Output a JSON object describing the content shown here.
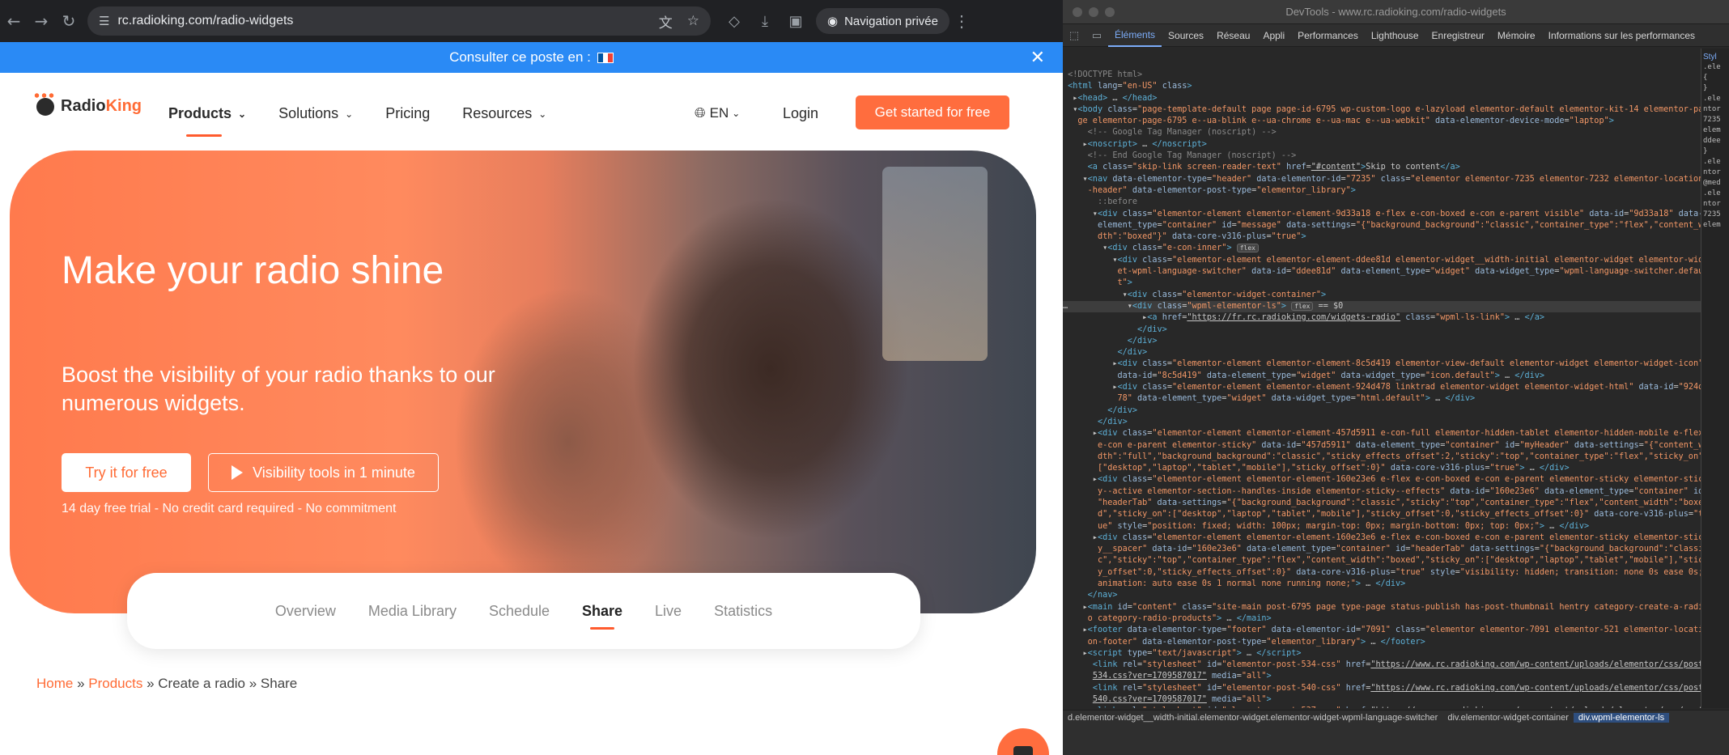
{
  "browser": {
    "url": "rc.radioking.com/radio-widgets",
    "incognito_label": "Navigation privée"
  },
  "banner": {
    "text": "Consulter ce poste en :",
    "flag_colors": [
      "#0055a4",
      "#ffffff",
      "#ef4135"
    ]
  },
  "header": {
    "logo_radio": "Radio",
    "logo_king": "King",
    "menu": [
      {
        "label": "Products",
        "dropdown": true,
        "active": true
      },
      {
        "label": "Solutions",
        "dropdown": true,
        "active": false
      },
      {
        "label": "Pricing",
        "dropdown": false,
        "active": false
      },
      {
        "label": "Resources",
        "dropdown": true,
        "active": false
      }
    ],
    "lang": "EN",
    "login": "Login",
    "cta": "Get started for free"
  },
  "hero": {
    "title": "Make your radio shine",
    "subtitle": "Boost the visibility of your radio thanks to our numerous widgets.",
    "try_button": "Try it for free",
    "video_button": "Visibility tools in 1 minute",
    "trial_text": "14 day free trial - No credit card required - No commitment"
  },
  "tabs": [
    "Overview",
    "Media Library",
    "Schedule",
    "Share",
    "Live",
    "Statistics"
  ],
  "active_tab": "Share",
  "breadcrumb": {
    "home": "Home",
    "products": "Products",
    "rest": "» Create a radio » Share"
  },
  "colors": {
    "accent": "#ff6d3e",
    "banner": "#2a8af5"
  },
  "devtools": {
    "title": "DevTools - www.rc.radioking.com/radio-widgets",
    "tabs": [
      "Éléments",
      "Sources",
      "Réseau",
      "Appli",
      "Performances",
      "Lighthouse",
      "Enregistreur",
      "Mémoire",
      "Informations sur les performances"
    ],
    "active_tab": "Éléments",
    "side_tab": "Styl",
    "breadcrumbs": [
      "d.elementor-widget__width-initial.elementor-widget.elementor-widget-wpml-language-switcher",
      "div.elementor-widget-container",
      "div.wpml-elementor-ls"
    ]
  }
}
